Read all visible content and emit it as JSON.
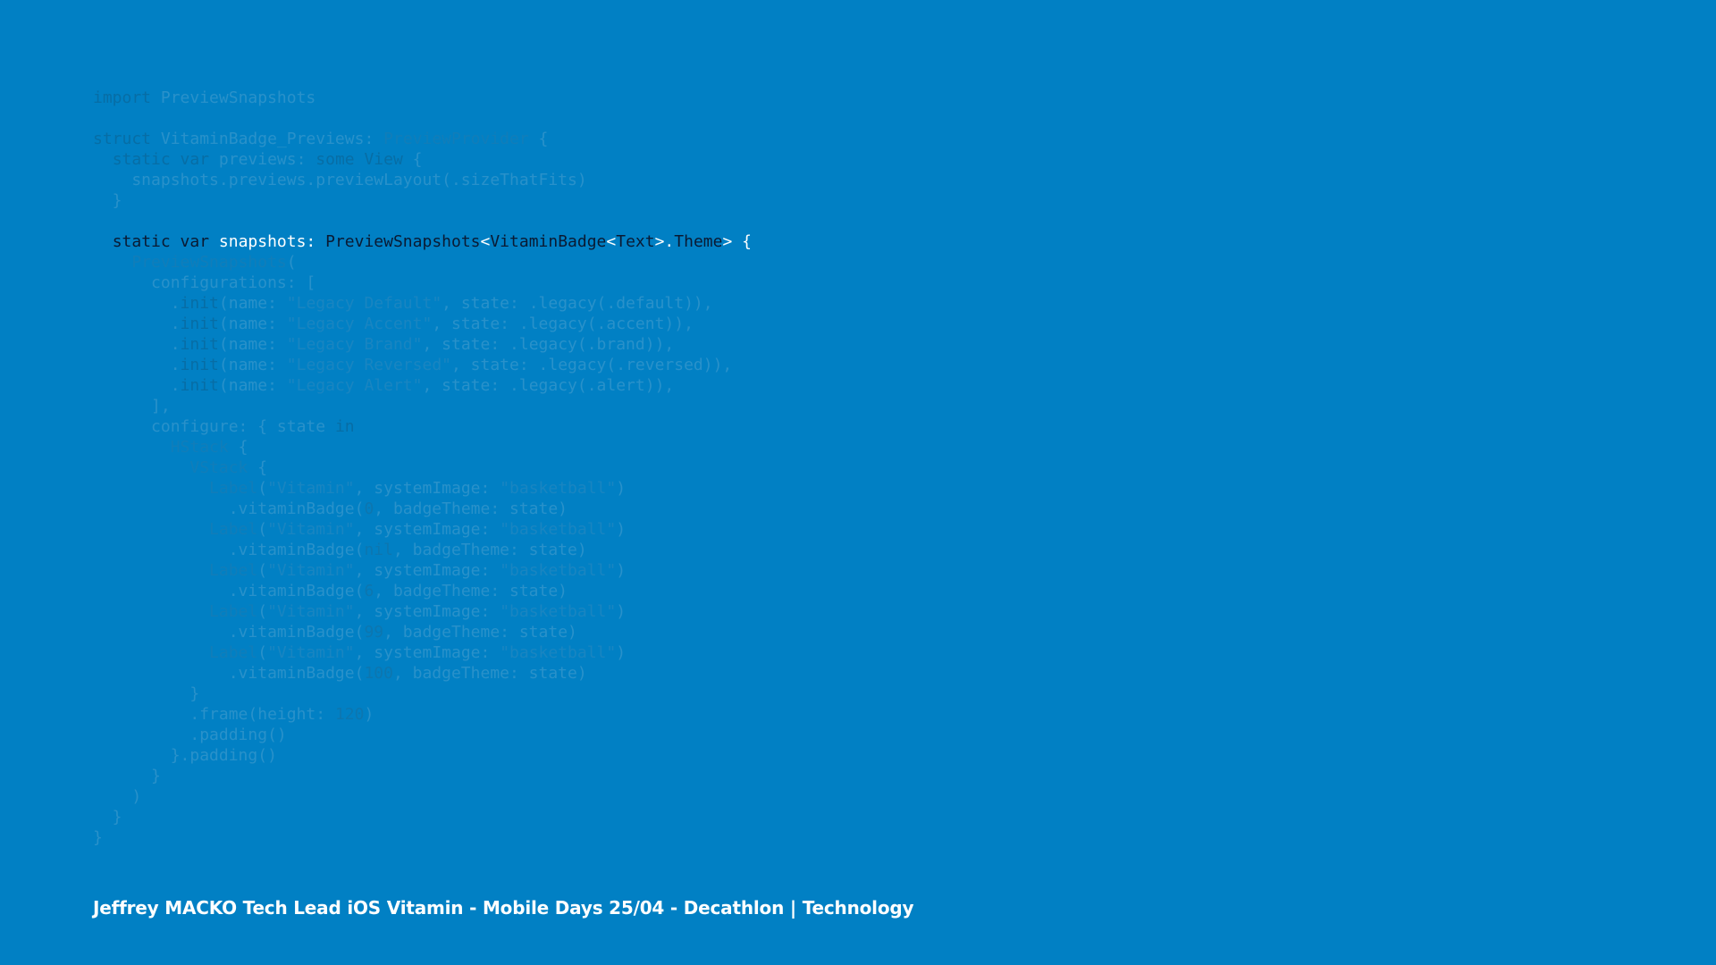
{
  "theme": {
    "background": "#0180C4",
    "focus_line": 7
  },
  "code": {
    "language": "swift",
    "lines": [
      [
        {
          "t": "import",
          "c": "kw"
        },
        {
          "t": " PreviewSnapshots",
          "c": "id"
        }
      ],
      [],
      [
        {
          "t": "struct",
          "c": "kw"
        },
        {
          "t": " VitaminBadge_Previews",
          "c": "id"
        },
        {
          "t": ": ",
          "c": "id"
        },
        {
          "t": "PreviewProvider",
          "c": "type"
        },
        {
          "t": " {",
          "c": "id"
        }
      ],
      [
        {
          "t": "  ",
          "c": "id"
        },
        {
          "t": "static var",
          "c": "kw"
        },
        {
          "t": " previews: ",
          "c": "id"
        },
        {
          "t": "some View",
          "c": "kw"
        },
        {
          "t": " {",
          "c": "id"
        }
      ],
      [
        {
          "t": "    snapshots.previews.previewLayout(.sizeThatFits)",
          "c": "id"
        }
      ],
      [
        {
          "t": "  }",
          "c": "id"
        }
      ],
      [],
      [
        {
          "t": "  ",
          "c": "id"
        },
        {
          "t": "static var",
          "c": "kw"
        },
        {
          "t": " snapshots: ",
          "c": "id"
        },
        {
          "t": "PreviewSnapshots",
          "c": "type"
        },
        {
          "t": "<",
          "c": "id"
        },
        {
          "t": "VitaminBadge",
          "c": "type"
        },
        {
          "t": "<",
          "c": "id"
        },
        {
          "t": "Text",
          "c": "type"
        },
        {
          "t": ">.",
          "c": "id"
        },
        {
          "t": "Theme",
          "c": "type"
        },
        {
          "t": "> {",
          "c": "id"
        }
      ],
      [
        {
          "t": "    ",
          "c": "id"
        },
        {
          "t": "PreviewSnapshots",
          "c": "type"
        },
        {
          "t": "(",
          "c": "id"
        }
      ],
      [
        {
          "t": "      configurations: [",
          "c": "id"
        }
      ],
      [
        {
          "t": "        .",
          "c": "id"
        },
        {
          "t": "init",
          "c": "kw"
        },
        {
          "t": "(name: ",
          "c": "id"
        },
        {
          "t": "\"Legacy Default\"",
          "c": "str"
        },
        {
          "t": ", state: .legacy(.default)),",
          "c": "id"
        }
      ],
      [
        {
          "t": "        .",
          "c": "id"
        },
        {
          "t": "init",
          "c": "kw"
        },
        {
          "t": "(name: ",
          "c": "id"
        },
        {
          "t": "\"Legacy Accent\"",
          "c": "str"
        },
        {
          "t": ", state: .legacy(.accent)),",
          "c": "id"
        }
      ],
      [
        {
          "t": "        .",
          "c": "id"
        },
        {
          "t": "init",
          "c": "kw"
        },
        {
          "t": "(name: ",
          "c": "id"
        },
        {
          "t": "\"Legacy Brand\"",
          "c": "str"
        },
        {
          "t": ", state: .legacy(.brand)),",
          "c": "id"
        }
      ],
      [
        {
          "t": "        .",
          "c": "id"
        },
        {
          "t": "init",
          "c": "kw"
        },
        {
          "t": "(name: ",
          "c": "id"
        },
        {
          "t": "\"Legacy Reversed\"",
          "c": "str"
        },
        {
          "t": ", state: .legacy(.reversed)),",
          "c": "id"
        }
      ],
      [
        {
          "t": "        .",
          "c": "id"
        },
        {
          "t": "init",
          "c": "kw"
        },
        {
          "t": "(name: ",
          "c": "id"
        },
        {
          "t": "\"Legacy Alert\"",
          "c": "str"
        },
        {
          "t": ", state: .legacy(.alert)),",
          "c": "id"
        }
      ],
      [
        {
          "t": "      ],",
          "c": "id"
        }
      ],
      [
        {
          "t": "      configure: { state ",
          "c": "id"
        },
        {
          "t": "in",
          "c": "kw"
        }
      ],
      [
        {
          "t": "        ",
          "c": "id"
        },
        {
          "t": "HStack",
          "c": "type"
        },
        {
          "t": " {",
          "c": "id"
        }
      ],
      [
        {
          "t": "          ",
          "c": "id"
        },
        {
          "t": "VStack",
          "c": "type"
        },
        {
          "t": " {",
          "c": "id"
        }
      ],
      [
        {
          "t": "            ",
          "c": "id"
        },
        {
          "t": "Label",
          "c": "type"
        },
        {
          "t": "(",
          "c": "id"
        },
        {
          "t": "\"Vitamin\"",
          "c": "str"
        },
        {
          "t": ", systemImage: ",
          "c": "id"
        },
        {
          "t": "\"basketball\"",
          "c": "str"
        },
        {
          "t": ")",
          "c": "id"
        }
      ],
      [
        {
          "t": "              .vitaminBadge(",
          "c": "id"
        },
        {
          "t": "0",
          "c": "num"
        },
        {
          "t": ", badgeTheme: state)",
          "c": "id"
        }
      ],
      [
        {
          "t": "            ",
          "c": "id"
        },
        {
          "t": "Label",
          "c": "type"
        },
        {
          "t": "(",
          "c": "id"
        },
        {
          "t": "\"Vitamin\"",
          "c": "str"
        },
        {
          "t": ", systemImage: ",
          "c": "id"
        },
        {
          "t": "\"basketball\"",
          "c": "str"
        },
        {
          "t": ")",
          "c": "id"
        }
      ],
      [
        {
          "t": "              .vitaminBadge(",
          "c": "id"
        },
        {
          "t": "nil",
          "c": "num"
        },
        {
          "t": ", badgeTheme: state)",
          "c": "id"
        }
      ],
      [
        {
          "t": "            ",
          "c": "id"
        },
        {
          "t": "Label",
          "c": "type"
        },
        {
          "t": "(",
          "c": "id"
        },
        {
          "t": "\"Vitamin\"",
          "c": "str"
        },
        {
          "t": ", systemImage: ",
          "c": "id"
        },
        {
          "t": "\"basketball\"",
          "c": "str"
        },
        {
          "t": ")",
          "c": "id"
        }
      ],
      [
        {
          "t": "              .vitaminBadge(",
          "c": "id"
        },
        {
          "t": "6",
          "c": "num"
        },
        {
          "t": ", badgeTheme: state)",
          "c": "id"
        }
      ],
      [
        {
          "t": "            ",
          "c": "id"
        },
        {
          "t": "Label",
          "c": "type"
        },
        {
          "t": "(",
          "c": "id"
        },
        {
          "t": "\"Vitamin\"",
          "c": "str"
        },
        {
          "t": ", systemImage: ",
          "c": "id"
        },
        {
          "t": "\"basketball\"",
          "c": "str"
        },
        {
          "t": ")",
          "c": "id"
        }
      ],
      [
        {
          "t": "              .vitaminBadge(",
          "c": "id"
        },
        {
          "t": "99",
          "c": "num"
        },
        {
          "t": ", badgeTheme: state)",
          "c": "id"
        }
      ],
      [
        {
          "t": "            ",
          "c": "id"
        },
        {
          "t": "Label",
          "c": "type"
        },
        {
          "t": "(",
          "c": "id"
        },
        {
          "t": "\"Vitamin\"",
          "c": "str"
        },
        {
          "t": ", systemImage: ",
          "c": "id"
        },
        {
          "t": "\"basketball\"",
          "c": "str"
        },
        {
          "t": ")",
          "c": "id"
        }
      ],
      [
        {
          "t": "              .vitaminBadge(",
          "c": "id"
        },
        {
          "t": "100",
          "c": "num"
        },
        {
          "t": ", badgeTheme: state)",
          "c": "id"
        }
      ],
      [
        {
          "t": "          }",
          "c": "id"
        }
      ],
      [
        {
          "t": "          .frame(height: ",
          "c": "id"
        },
        {
          "t": "120",
          "c": "num"
        },
        {
          "t": ")",
          "c": "id"
        }
      ],
      [
        {
          "t": "          .padding()",
          "c": "id"
        }
      ],
      [
        {
          "t": "        }.padding()",
          "c": "id"
        }
      ],
      [
        {
          "t": "      }",
          "c": "id"
        }
      ],
      [
        {
          "t": "    )",
          "c": "id"
        }
      ],
      [
        {
          "t": "  }",
          "c": "id"
        }
      ],
      [
        {
          "t": "}",
          "c": "id"
        }
      ]
    ]
  },
  "footer": {
    "text": "Jeffrey MACKO Tech Lead iOS Vitamin - Mobile Days 25/04 - Decathlon | Technology"
  }
}
